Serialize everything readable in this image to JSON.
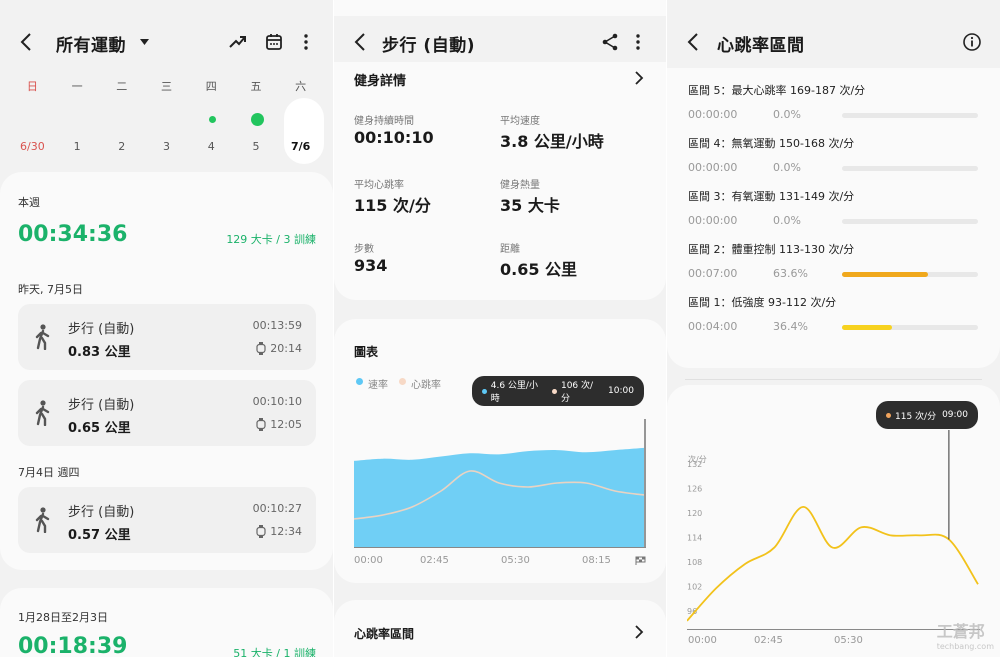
{
  "screen1": {
    "title": "所有運動",
    "week_names": [
      "日",
      "一",
      "二",
      "三",
      "四",
      "五",
      "六"
    ],
    "week_dates": [
      "6/30",
      "1",
      "2",
      "3",
      "4",
      "5",
      "7/6"
    ],
    "this_week": {
      "label": "本週",
      "duration": "00:34:36",
      "summary": "129 大卡 / 3 訓練"
    },
    "groups": [
      {
        "heading": "昨天, 7月5日",
        "items": [
          {
            "name": "步行 (自動)",
            "distance": "0.83 公里",
            "duration": "00:13:59",
            "time": "20:14"
          },
          {
            "name": "步行 (自動)",
            "distance": "0.65 公里",
            "duration": "00:10:10",
            "time": "12:05"
          }
        ]
      },
      {
        "heading": "7月4日 週四",
        "items": [
          {
            "name": "步行 (自動)",
            "distance": "0.57 公里",
            "duration": "00:10:27",
            "time": "12:34"
          }
        ]
      }
    ],
    "prev_week": {
      "label": "1月28日至2月3日",
      "duration": "00:18:39",
      "summary": "51 大卡 / 1 訓練"
    }
  },
  "screen2": {
    "title": "步行 (自動)",
    "details_title": "健身詳情",
    "stats": [
      {
        "label": "健身持續時間",
        "value": "00:10:10"
      },
      {
        "label": "平均速度",
        "value": "3.8 公里/小時"
      },
      {
        "label": "平均心跳率",
        "value": "115 次/分"
      },
      {
        "label": "健身熱量",
        "value": "35 大卡"
      },
      {
        "label": "步數",
        "value": "934"
      },
      {
        "label": "距離",
        "value": "0.65 公里"
      }
    ],
    "chart_title": "圖表",
    "legend": {
      "speed": "速率",
      "hr": "心跳率"
    },
    "tooltip": {
      "speed": "4.6 公里/小時",
      "hr": "106 次/分",
      "time": "10:00"
    },
    "x_ticks": [
      "00:00",
      "02:45",
      "05:30",
      "08:15"
    ],
    "hr_zone_title": "心跳率區間"
  },
  "screen3": {
    "title": "心跳率區間",
    "zones": [
      {
        "label": "區間 5：最大心跳率  169-187 次/分",
        "time": "00:00:00",
        "pct": "0.0%",
        "fill": 0.0,
        "color": "#f59e0b"
      },
      {
        "label": "區間 4：無氧運動  150-168 次/分",
        "time": "00:00:00",
        "pct": "0.0%",
        "fill": 0.0,
        "color": "#f59e0b"
      },
      {
        "label": "區間 3：有氧運動  131-149 次/分",
        "time": "00:00:00",
        "pct": "0.0%",
        "fill": 0.0,
        "color": "#f59e0b"
      },
      {
        "label": "區間 2：體重控制  113-130 次/分",
        "time": "00:07:00",
        "pct": "63.6%",
        "fill": 0.636,
        "color": "#f0a81c"
      },
      {
        "label": "區間 1：低強度  93-112 次/分",
        "time": "00:04:00",
        "pct": "36.4%",
        "fill": 0.364,
        "color": "#f7d21f"
      }
    ],
    "tooltip": {
      "hr": "115 次/分",
      "time": "09:00"
    },
    "y_unit": "次/分",
    "y_ticks": [
      "132",
      "126",
      "120",
      "114",
      "108",
      "102",
      "96"
    ],
    "x_ticks": [
      "00:00",
      "02:45",
      "05:30"
    ],
    "watermark": "工蒼邦",
    "watermark_sub": "techbang.com"
  },
  "chart_data": [
    {
      "type": "area",
      "title": "圖表",
      "xlabel": "",
      "ylabel": "",
      "x": [
        "00:00",
        "01:00",
        "02:00",
        "03:00",
        "04:00",
        "05:00",
        "06:00",
        "07:00",
        "08:00",
        "09:00",
        "10:00"
      ],
      "series": [
        {
          "name": "速率",
          "values": [
            4.0,
            4.1,
            4.05,
            4.2,
            4.35,
            4.3,
            4.45,
            4.5,
            4.4,
            4.5,
            4.6
          ]
        },
        {
          "name": "心跳率",
          "values": [
            94,
            96,
            100,
            108,
            118,
            112,
            110,
            112,
            112,
            108,
            106
          ]
        }
      ]
    },
    {
      "type": "line",
      "title": "",
      "xlabel": "",
      "ylabel": "次/分",
      "ylim": [
        93,
        135
      ],
      "x": [
        "00:00",
        "01:00",
        "02:00",
        "03:00",
        "04:00",
        "05:00",
        "06:00",
        "07:00",
        "08:00",
        "09:00",
        "10:00"
      ],
      "series": [
        {
          "name": "",
          "values": [
            95,
            103,
            109,
            113,
            123,
            113,
            118,
            116,
            116,
            115,
            104
          ]
        }
      ]
    }
  ]
}
